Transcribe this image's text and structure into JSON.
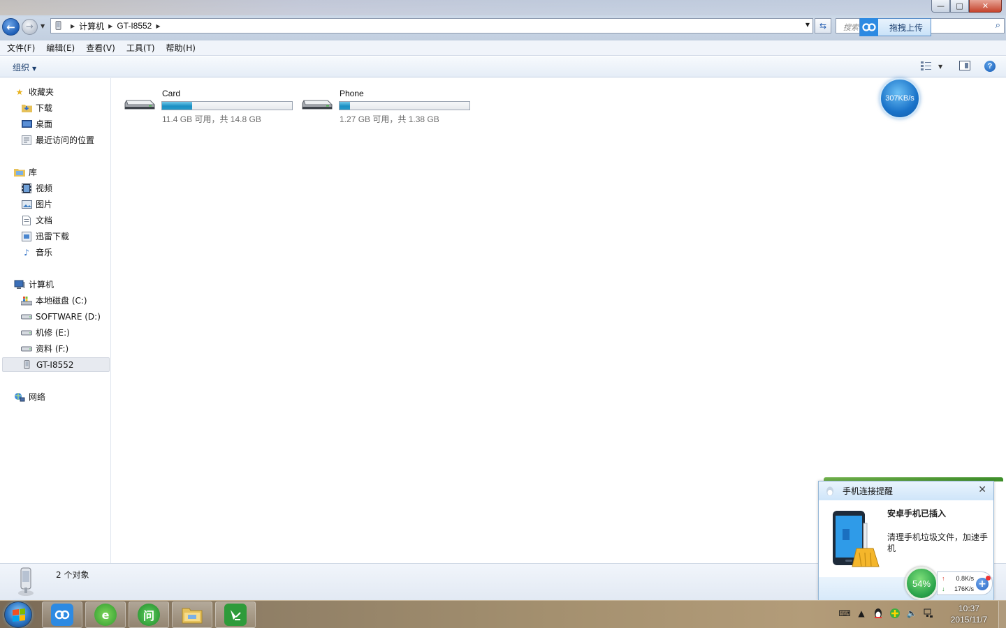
{
  "window": {
    "search_placeholder": "搜索",
    "breadcrumb": [
      "计算机",
      "GT-I8552"
    ],
    "upload_label": "拖拽上传",
    "controls": {
      "minimize": "—",
      "maximize": "□",
      "close": "✕"
    }
  },
  "menu": [
    "文件(F)",
    "编辑(E)",
    "查看(V)",
    "工具(T)",
    "帮助(H)"
  ],
  "toolbar": {
    "organize_label": "组织",
    "help_label": "?"
  },
  "navpane": {
    "favorites": {
      "label": "收藏夹",
      "items": [
        "下载",
        "桌面",
        "最近访问的位置"
      ]
    },
    "libraries": {
      "label": "库",
      "items": [
        "视频",
        "图片",
        "文档",
        "迅雷下载",
        "音乐"
      ]
    },
    "computer": {
      "label": "计算机",
      "items": [
        "本地磁盘 (C:)",
        "SOFTWARE (D:)",
        "机修 (E:)",
        "资料 (F:)",
        "GT-I8552"
      ],
      "selected": "GT-I8552"
    },
    "network": {
      "label": "网络"
    }
  },
  "drives": [
    {
      "name": "Card",
      "free_text": "11.4 GB 可用，共 14.8 GB",
      "used_fraction": 0.23
    },
    {
      "name": "Phone",
      "free_text": "1.27 GB 可用，共 1.38 GB",
      "used_fraction": 0.08
    }
  ],
  "speed_widget": {
    "value": "307KB/s"
  },
  "status": {
    "count_text": "2 个对象"
  },
  "notification": {
    "header": "手机连接提醒",
    "title": "安卓手机已插入",
    "message": "清理手机垃圾文件，加速手机",
    "memory": "54%",
    "upload_speed": "0.8K/s",
    "download_speed": "176K/s"
  },
  "taskbar": {
    "time": "10:37",
    "date": "2015/11/7",
    "apps": [
      "baidu-cloud",
      "360-browser",
      "iwenwen",
      "explorer",
      "file-transfer"
    ]
  },
  "colors": {
    "accent": "#1b8fc3",
    "brand_blue": "#2d8ae2",
    "green": "#2aa34a"
  }
}
